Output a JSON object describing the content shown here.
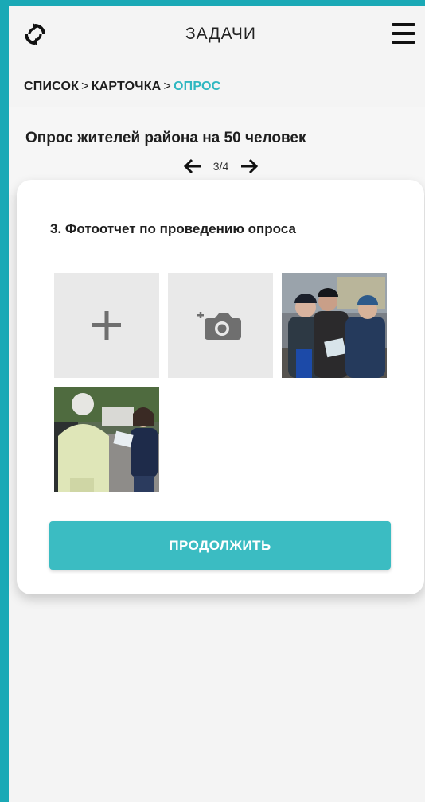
{
  "header": {
    "title": "ЗАДАЧИ",
    "refresh_icon": "refresh-icon",
    "menu_icon": "hamburger-menu-icon"
  },
  "breadcrumb": {
    "items": [
      "СПИСОК",
      "КАРТОЧКА",
      "ОПРОС"
    ],
    "separator": ">",
    "active_color": "#2fb7c1"
  },
  "task": {
    "title": "Опрос жителей района на 50 человек",
    "pager": {
      "text": "3/4",
      "prev_icon": "arrow-left-icon",
      "next_icon": "arrow-right-icon"
    }
  },
  "card": {
    "question": "3. Фотоотчет по проведению опроса",
    "tiles": [
      {
        "kind": "add",
        "icon": "plus-icon"
      },
      {
        "kind": "camera",
        "icon": "add-camera-icon"
      },
      {
        "kind": "photo",
        "icon": "photo-thumbnail-1"
      },
      {
        "kind": "photo",
        "icon": "photo-thumbnail-2"
      }
    ],
    "continue_label": "ПРОДОЛЖИТЬ"
  },
  "colors": {
    "frame": "#1aa9b6",
    "accent": "#3bbcc2",
    "background": "#f4f4f4"
  }
}
